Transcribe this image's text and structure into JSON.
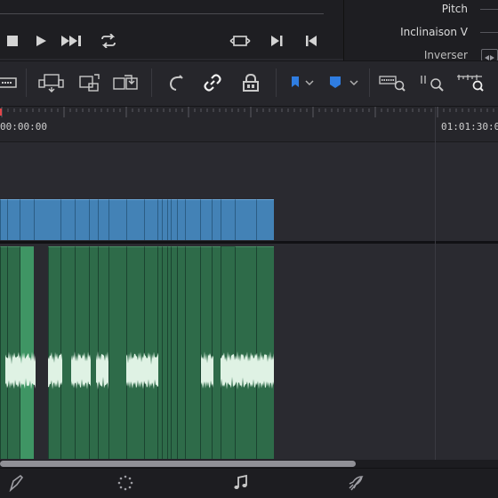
{
  "inspector": {
    "pitch_label": "Pitch",
    "tilt_label": "Inclinaison V",
    "flip_label": "Inverser"
  },
  "ruler": {
    "start_timecode": "00:00:00",
    "marker_timecode": "01:01:30:00"
  },
  "transport": {
    "buttons": [
      "stop-icon",
      "play-icon",
      "fast-forward-icon",
      "loop-icon",
      "match-frame-icon",
      "next-clip-icon",
      "prev-clip-icon"
    ]
  },
  "toolbar": {
    "tools": [
      "trim-edit-icon",
      "insert-icon",
      "overwrite-icon",
      "replace-icon",
      "snapping-icon",
      "link-icon",
      "lock-icon",
      "flag-icon",
      "marker-icon",
      "zoom-full-icon",
      "zoom-detail-icon",
      "zoom-custom-icon"
    ]
  },
  "colors": {
    "video_clip": "#4382b6",
    "audio_clip": "#2e6b49",
    "audio_clip_selected": "#3f9564",
    "flag_accent": "#2f7de1"
  },
  "pages": [
    "edit-page-icon",
    "fusion-page-icon",
    "fairlight-page-icon",
    "deliver-page-icon"
  ]
}
